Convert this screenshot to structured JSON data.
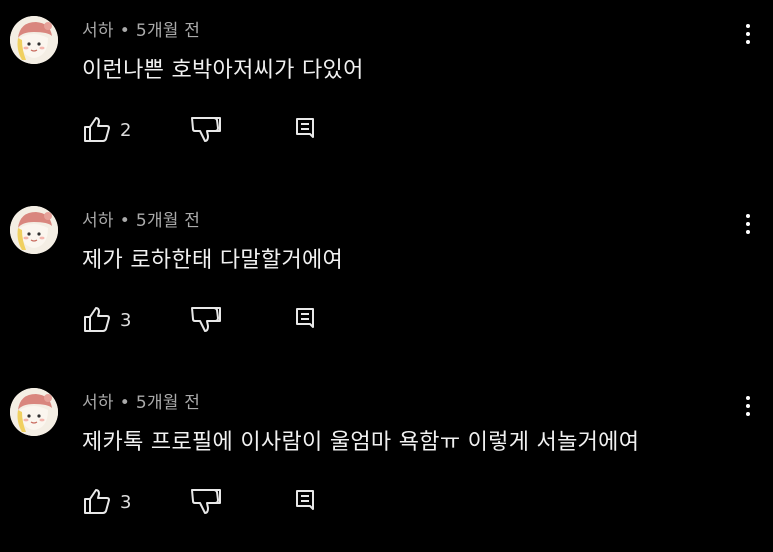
{
  "comments": [
    {
      "author": "서하",
      "separator": "•",
      "time": "5개월 전",
      "text": "이런나쁜 호박아저씨가 다있어",
      "likes": "2"
    },
    {
      "author": "서하",
      "separator": "•",
      "time": "5개월 전",
      "text": "제가 로하한태 다말할거에여",
      "likes": "3"
    },
    {
      "author": "서하",
      "separator": "•",
      "time": "5개월 전",
      "text": "제카톡 프로필에 이사람이 울엄마 욕함ㅠ 이렇게 서놀거에여",
      "likes": "3"
    }
  ],
  "icons": {
    "like": "thumbs-up-icon",
    "dislike": "thumbs-down-icon",
    "reply": "reply-icon",
    "more": "more-vert-icon"
  },
  "colors": {
    "background": "#000000",
    "text": "#f1f1f1",
    "meta": "#aaaaaa",
    "avatar_hat": "#d9867e",
    "avatar_bg": "#f4eee4"
  }
}
